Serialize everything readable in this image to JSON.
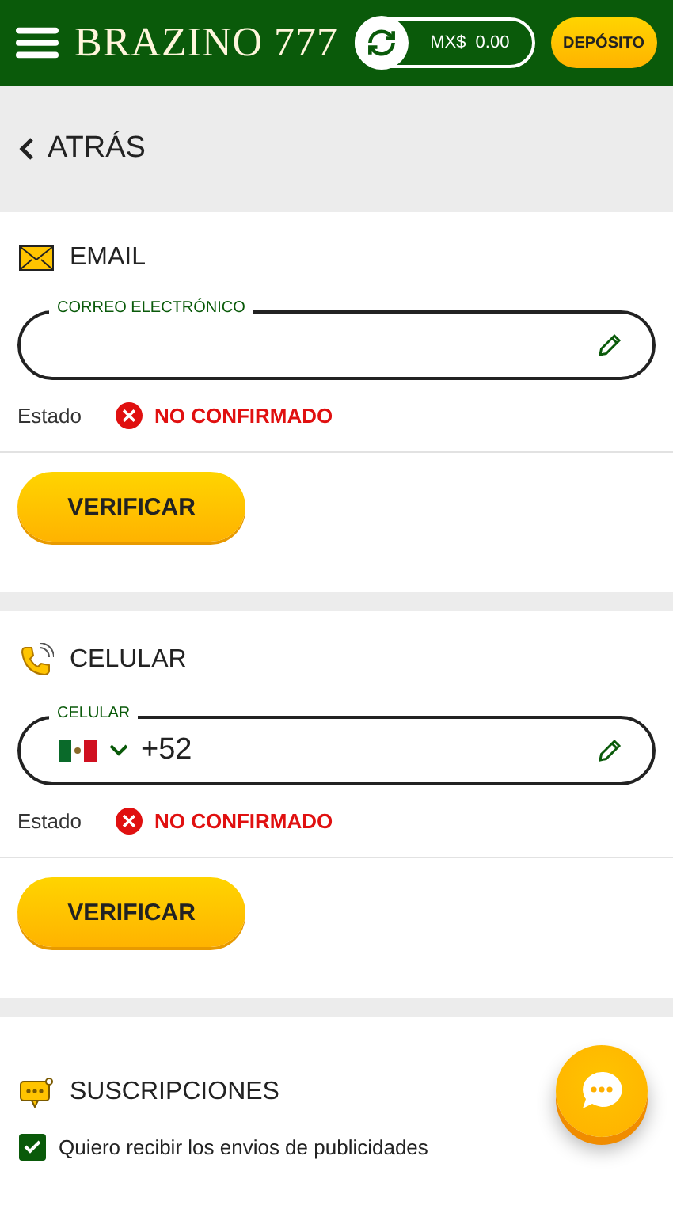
{
  "header": {
    "logo": "BRAZINO 777",
    "balance": "MX$  0.00",
    "deposit_button": "DEPÓSITO"
  },
  "back_link": "ATRÁS",
  "sections": [
    {
      "kind": "email",
      "title": "EMAIL",
      "field_label": "CORREO ELECTRÓNICO",
      "status_label": "Estado",
      "status": "NO CONFIRMADO",
      "confirmed": false,
      "button": "VERIFICAR"
    },
    {
      "kind": "phone",
      "title": "CELULAR",
      "field_label": "CELULAR",
      "value": "+52",
      "status_label": "Estado",
      "status": "NO CONFIRMADO",
      "confirmed": false,
      "button": "VERIFICAR"
    }
  ],
  "subscriptions": {
    "title": "SUSCRIPCIONES",
    "option": {
      "label": "Quiero recibir los envios de publicidades",
      "checked": true
    }
  }
}
